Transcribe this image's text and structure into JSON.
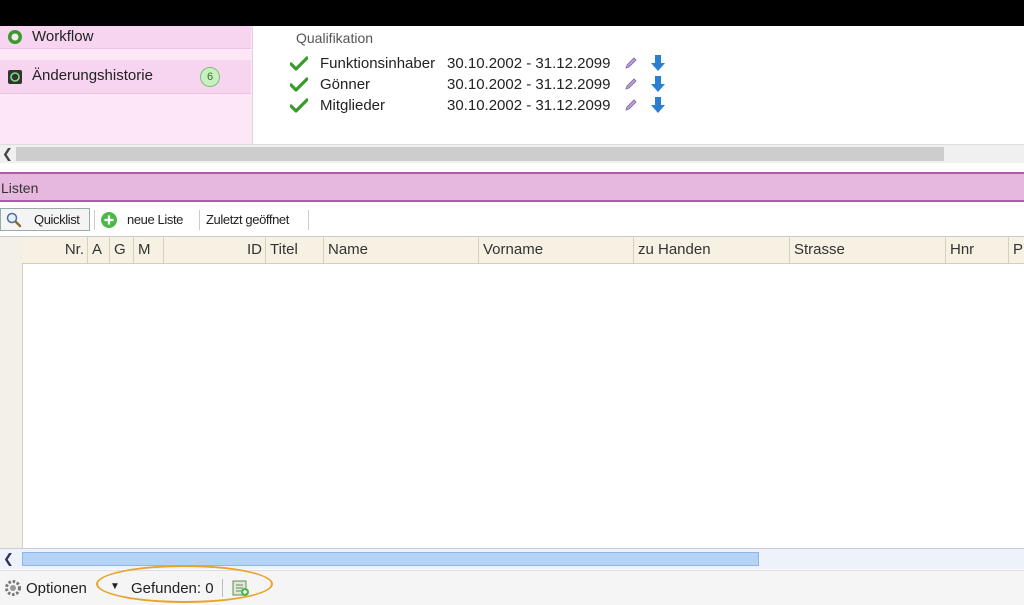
{
  "nav": {
    "items": [
      {
        "label": "Workflow",
        "icon": "workflow-icon"
      },
      {
        "label": "Änderungshistorie",
        "icon": "history-icon",
        "badge": "6"
      }
    ]
  },
  "qualifikation": {
    "title": "Qualifikation",
    "rows": [
      {
        "name": "Funktionsinhaber",
        "range": "30.10.2002 - 31.12.2099"
      },
      {
        "name": "Gönner",
        "range": "30.10.2002 - 31.12.2099"
      },
      {
        "name": "Mitglieder",
        "range": "30.10.2002 - 31.12.2099"
      }
    ]
  },
  "section": {
    "title": "Listen"
  },
  "toolbar": {
    "quicklist": "Quicklist",
    "new_list": "neue Liste",
    "recent": "Zuletzt geöffnet"
  },
  "grid": {
    "columns": [
      "Nr.",
      "A",
      "G",
      "M",
      "ID",
      "Titel",
      "Name",
      "Vorname",
      "zu Handen",
      "Strasse",
      "Hnr",
      "P"
    ],
    "rows": []
  },
  "status": {
    "options": "Optionen",
    "found": "Gefunden: 0"
  },
  "colors": {
    "nav_bg": "#f7d4ef",
    "section_bg": "#e7b8df",
    "section_border": "#b25aa6",
    "check": "#3a9a2c",
    "arrow": "#2a7fd4",
    "highlight_circle": "#e8a32a"
  }
}
